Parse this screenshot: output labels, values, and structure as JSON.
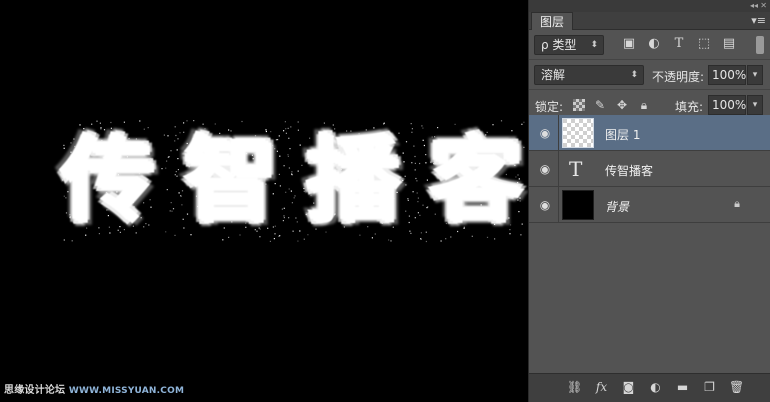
{
  "canvas": {
    "glyphs": [
      "传",
      "智",
      "播",
      "客"
    ],
    "watermark": {
      "site_name": "思缘设计论坛",
      "site_url": "WWW.MISSYUAN.COM"
    }
  },
  "panel": {
    "tab_label": "图层",
    "filter": {
      "kind_label": "ρ 类型",
      "icons": [
        "image-filter-icon",
        "adjustment-filter-icon",
        "type-filter-icon",
        "shape-filter-icon",
        "smart-object-filter-icon"
      ]
    },
    "blend": {
      "mode": "溶解",
      "opacity_label": "不透明度:",
      "opacity_value": "100%"
    },
    "lock": {
      "label": "锁定:",
      "fill_label": "填充:",
      "fill_value": "100%"
    },
    "layers": [
      {
        "name": "图层 1",
        "kind": "pixel",
        "selected": true
      },
      {
        "name": "传智播客",
        "kind": "type",
        "selected": false
      },
      {
        "name": "背景",
        "kind": "background",
        "selected": false,
        "locked": true
      }
    ],
    "bottom_icons": [
      "link-layers-icon",
      "fx-icon",
      "add-mask-icon",
      "adjustment-layer-icon",
      "new-group-icon",
      "new-layer-icon",
      "delete-layer-icon"
    ],
    "fx_label": "fx",
    "type_glyph": "T",
    "colors": {
      "panel_bg": "#535353",
      "selected_layer": "#5a6e86",
      "canvas_bg": "#000000"
    }
  }
}
